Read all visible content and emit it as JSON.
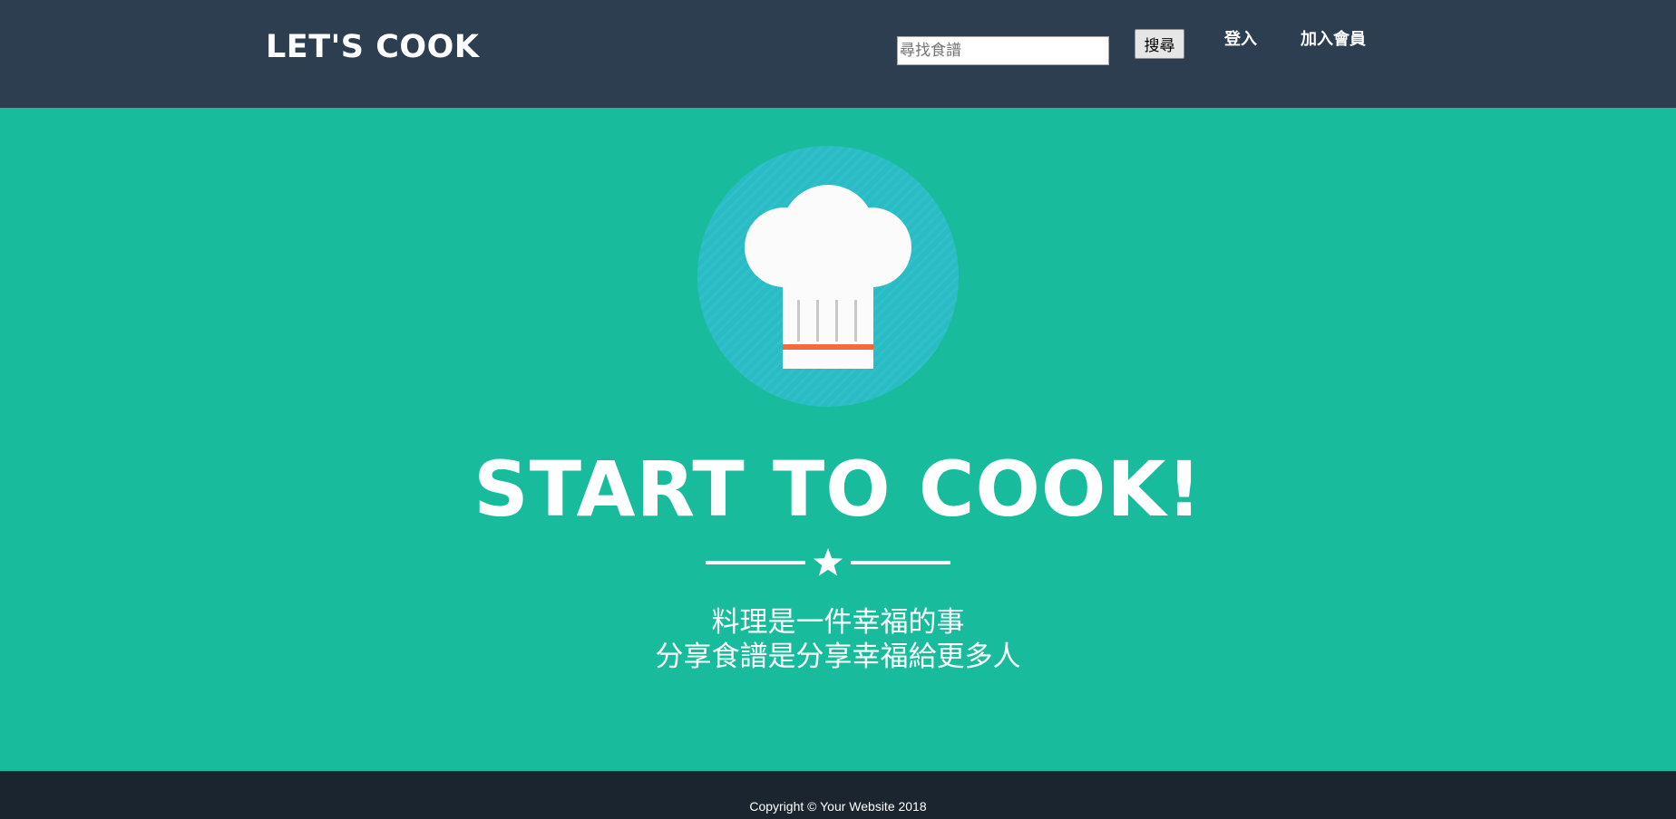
{
  "header": {
    "brand": "LET'S COOK",
    "search": {
      "placeholder": "尋找食譜",
      "value": "",
      "button_label": "搜尋"
    },
    "nav": {
      "login_label": "登入",
      "join_label": "加入會員"
    }
  },
  "hero": {
    "avatar_icon": "chef-hat-icon",
    "headline": "START TO COOK!",
    "divider_icon": "star-icon",
    "subtext_lines": [
      "料理是一件幸福的事",
      "分享食譜是分享幸福給更多人"
    ]
  },
  "footer": {
    "copyright": "Copyright © Your Website 2018"
  },
  "colors": {
    "navbar": "#2c3e50",
    "hero_background": "#18bc9c",
    "avatar_circle": "#2bbbc4",
    "hat_stripe": "#f26b3a",
    "footer": "#1a252f",
    "text": "#ffffff"
  }
}
